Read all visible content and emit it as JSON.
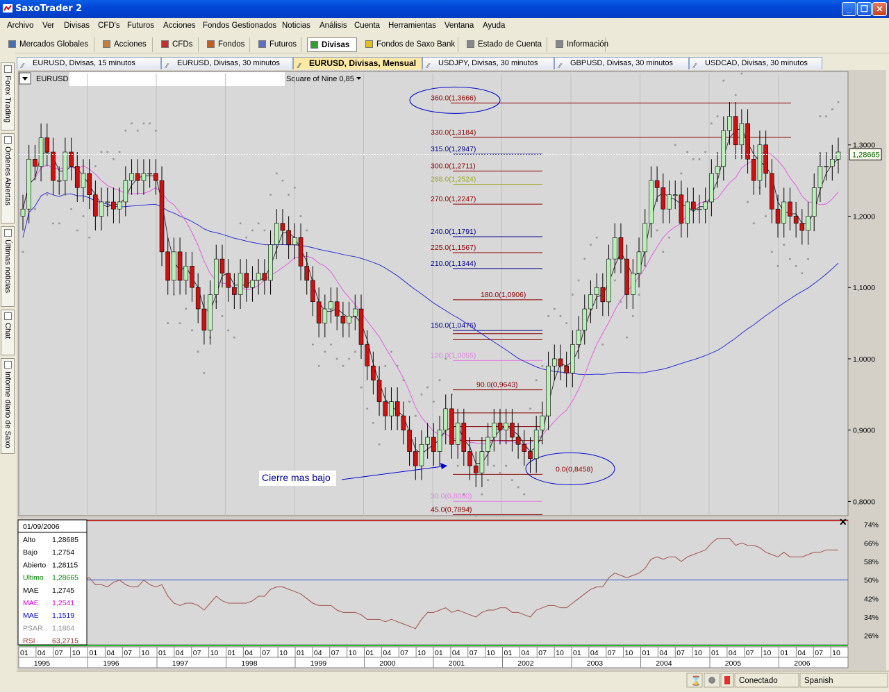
{
  "app": {
    "title": "SaxoTrader 2"
  },
  "menu": [
    "Archivo",
    "Ver",
    "Divisas",
    "CFD's",
    "Futuros",
    "Acciones",
    "Fondos Gestionados",
    "Noticias",
    "Análisis",
    "Cuenta",
    "Herramientas",
    "Ventana",
    "Ayuda"
  ],
  "toolbar": [
    "Mercados Globales",
    "Acciones",
    "CFDs",
    "Fondos",
    "Futuros",
    "Divisas",
    "Fondos de Saxo Bank",
    "Estado de Cuenta",
    "Información"
  ],
  "toolbar_active": "Divisas",
  "chart_tabs": [
    "EURUSD, Divisas, 15 minutos",
    "EURUSD, Divisas, 30 minutos",
    "EURUSD, Divisas, Mensual",
    "USDJPY, Divisas, 30 minutos",
    "GBPUSD, Divisas, 30 minutos",
    "USDCAD, Divisas, 30 minutos"
  ],
  "chart_tab_active": "EURUSD, Divisas, Mensual",
  "sidebar_tabs": [
    "Forex Trading",
    "Órdenes Abiertas",
    "Últimas noticias",
    "Chat",
    "Informe diario de Saxo"
  ],
  "chart_header": {
    "symbol": "EURUSD",
    "tool": "Square of Nine 0,85"
  },
  "annotation": "Cierre mas bajo",
  "info_panel": {
    "date": "01/09/2006",
    "rows": [
      {
        "label": "Alto",
        "value": "1,28685",
        "color": "#000000"
      },
      {
        "label": "Bajo",
        "value": "1,2754",
        "color": "#000000"
      },
      {
        "label": "Abierto",
        "value": "1,28115",
        "color": "#000000"
      },
      {
        "label": "Ultimo",
        "value": "1,28665",
        "color": "#008000"
      },
      {
        "label": "MAE",
        "value": "1,2745",
        "color": "#000000"
      },
      {
        "label": "MAE",
        "value": "1,2541",
        "color": "#d000d0"
      },
      {
        "label": "MAE",
        "value": "1,1519",
        "color": "#0000c0"
      },
      {
        "label": "PSAR",
        "value": "1,1864",
        "color": "#909090"
      },
      {
        "label": "RSI",
        "value": "63,2715",
        "color": "#a03030"
      }
    ]
  },
  "status": {
    "connection": "Conectado",
    "language": "Spanish"
  },
  "colors": {
    "up": "#b8f0b8",
    "down": "#cc1111",
    "mae_fast": "#333333",
    "mae_mid": "#e060e0",
    "mae_slow": "#3030d0",
    "psar": "#999999",
    "rsi": "#a05050"
  },
  "chart_data": {
    "type": "candlestick",
    "price_axis": {
      "ticks": [
        "0,8000",
        "0,9000",
        "1,0000",
        "1,1000",
        "1,2000",
        "1,3000"
      ],
      "min": 0.78,
      "max": 1.4,
      "current": "1,28665"
    },
    "years": [
      "1995",
      "1996",
      "1997",
      "1998",
      "1999",
      "2000",
      "2001",
      "2002",
      "2003",
      "2004",
      "2005",
      "2006"
    ],
    "months": [
      "01",
      "04",
      "07",
      "10"
    ],
    "rsi_axis": [
      "74%",
      "66%",
      "58%",
      "50%",
      "42%",
      "34%",
      "26%"
    ],
    "square_of_nine": [
      {
        "label": "360.0(1,3666)",
        "price": 1.3666,
        "color": "#8b0000",
        "circled": true
      },
      {
        "label": "330.0(1,3184)",
        "price": 1.3184,
        "color": "#8b0000"
      },
      {
        "label": "315.0(1,2947)",
        "price": 1.2947,
        "color": "#00008b"
      },
      {
        "label": "300.0(1,2711)",
        "price": 1.2711,
        "color": "#8b0000"
      },
      {
        "label": "288.0(1,2524)",
        "price": 1.2524,
        "color": "#9aa820"
      },
      {
        "label": "270.0(1,2247)",
        "price": 1.2247,
        "color": "#8b0000"
      },
      {
        "label": "240.0(1,1791)",
        "price": 1.1791,
        "color": "#00008b"
      },
      {
        "label": "225.0(1,1567)",
        "price": 1.1567,
        "color": "#8b0000"
      },
      {
        "label": "210.0(1,1344)",
        "price": 1.1344,
        "color": "#00008b"
      },
      {
        "label": "180.0(1,0906)",
        "price": 1.0906,
        "color": "#8b0000"
      },
      {
        "label": "150.0(1,0476)",
        "price": 1.0476,
        "color": "#00008b"
      },
      {
        "label": "120.0(1,0055)",
        "price": 1.0055,
        "color": "#e080e0"
      },
      {
        "label": "90.0(0,9643)",
        "price": 0.9643,
        "color": "#8b0000"
      },
      {
        "label": "0.0(0,8458)",
        "price": 0.8458,
        "color": "#8b0000",
        "circled": true
      },
      {
        "label": "30.0(0,8080)",
        "price": 0.808,
        "color": "#e080e0"
      },
      {
        "label": "45.0(0,7894)",
        "price": 0.7894,
        "color": "#8b0000"
      }
    ],
    "closes": [
      1.21,
      1.28,
      1.27,
      1.31,
      1.29,
      1.25,
      1.25,
      1.29,
      1.27,
      1.24,
      1.26,
      1.23,
      1.2,
      1.22,
      1.22,
      1.21,
      1.22,
      1.25,
      1.26,
      1.25,
      1.26,
      1.26,
      1.25,
      1.15,
      1.11,
      1.15,
      1.11,
      1.13,
      1.1,
      1.07,
      1.04,
      1.09,
      1.14,
      1.12,
      1.1,
      1.09,
      1.12,
      1.1,
      1.11,
      1.12,
      1.11,
      1.16,
      1.19,
      1.18,
      1.16,
      1.17,
      1.13,
      1.11,
      1.08,
      1.05,
      1.07,
      1.08,
      1.06,
      1.05,
      1.06,
      1.07,
      1.02,
      0.99,
      0.97,
      0.94,
      0.92,
      0.94,
      0.92,
      0.9,
      0.87,
      0.85,
      0.88,
      0.89,
      0.87,
      0.9,
      0.93,
      0.88,
      0.91,
      0.87,
      0.85,
      0.84,
      0.87,
      0.89,
      0.91,
      0.9,
      0.91,
      0.89,
      0.88,
      0.87,
      0.86,
      0.9,
      0.92,
      0.99,
      1.0,
      0.99,
      0.98,
      1.02,
      1.04,
      1.07,
      1.09,
      1.1,
      1.08,
      1.14,
      1.17,
      1.14,
      1.09,
      1.12,
      1.15,
      1.19,
      1.25,
      1.24,
      1.21,
      1.23,
      1.23,
      1.19,
      1.22,
      1.21,
      1.21,
      1.22,
      1.26,
      1.27,
      1.32,
      1.34,
      1.3,
      1.33,
      1.28,
      1.25,
      1.3,
      1.26,
      1.21,
      1.19,
      1.22,
      1.2,
      1.19,
      1.18,
      1.2,
      1.24,
      1.27,
      1.27,
      1.28,
      1.29
    ],
    "rsi_values": [
      50,
      50,
      49,
      47,
      46,
      44,
      47,
      43,
      46,
      48,
      50,
      51,
      48,
      48,
      47,
      49,
      50,
      48,
      47,
      47,
      50,
      48,
      47,
      48,
      43,
      40,
      39,
      40,
      40,
      39,
      37,
      40,
      43,
      41,
      40,
      40,
      40,
      40,
      41,
      43,
      43,
      46,
      47,
      47,
      46,
      45,
      44,
      42,
      40,
      39,
      39,
      39,
      37,
      36,
      36,
      36,
      35,
      33,
      33,
      33,
      32,
      33,
      32,
      31,
      30,
      29,
      33,
      36,
      36,
      37,
      38,
      36,
      37,
      36,
      35,
      34,
      36,
      37,
      37,
      38,
      38,
      36,
      36,
      35,
      34,
      37,
      38,
      39,
      39,
      38,
      38,
      40,
      42,
      44,
      46,
      47,
      47,
      51,
      53,
      52,
      51,
      52,
      53,
      55,
      59,
      60,
      59,
      60,
      60,
      58,
      60,
      61,
      62,
      63,
      66,
      68,
      68,
      68,
      65,
      66,
      65,
      65,
      64,
      62,
      61,
      60,
      62,
      60,
      60,
      60,
      61,
      62,
      62,
      63,
      63,
      63
    ]
  }
}
